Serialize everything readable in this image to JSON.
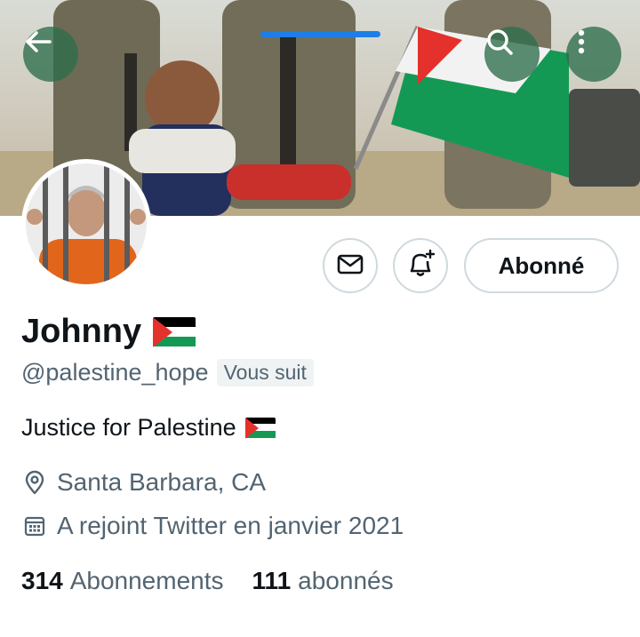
{
  "profile": {
    "name": "Johnny",
    "name_flag_icon": "palestine-flag-icon",
    "handle": "@palestine_hope",
    "follows_you_label": "Vous suit",
    "bio_text": "Justice for Palestine",
    "bio_flag_icon": "palestine-flag-icon",
    "location": "Santa Barbara, CA",
    "joined": "A rejoint Twitter en janvier 2021",
    "following_count": "314",
    "following_label": "Abonnements",
    "followers_count": "111",
    "followers_label": "abonnés"
  },
  "actions": {
    "follow_state_label": "Abonné",
    "message_icon": "envelope-icon",
    "notify_icon": "bell-plus-icon"
  },
  "header": {
    "back_icon": "arrow-left-icon",
    "search_icon": "search-icon",
    "more_icon": "more-vertical-icon"
  },
  "colors": {
    "accent": "#1d7ee8",
    "text_primary": "#0f1419",
    "text_secondary": "#536471",
    "button_border": "#cfd9de",
    "flag_black": "#000000",
    "flag_green": "#149954",
    "flag_red": "#e4312b"
  }
}
